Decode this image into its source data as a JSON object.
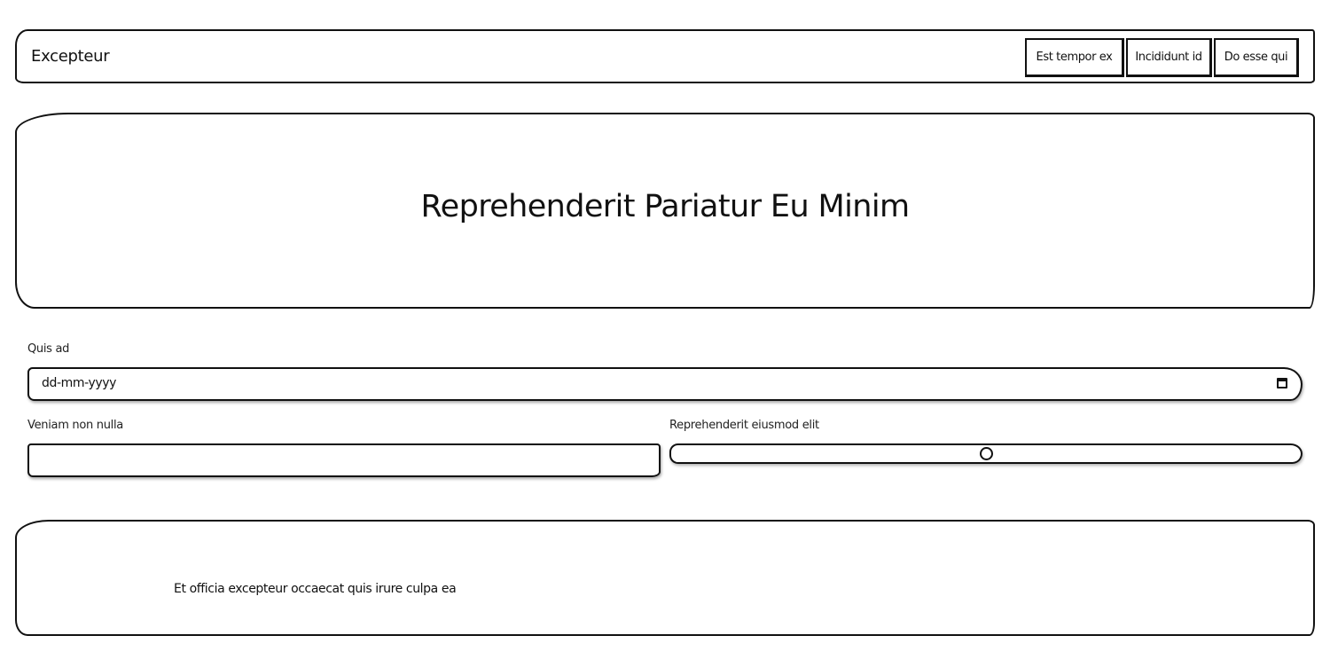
{
  "header": {
    "brand": "Excepteur",
    "nav": [
      {
        "label": "Est tempor ex"
      },
      {
        "label": "Incididunt id"
      },
      {
        "label": "Do esse qui"
      }
    ]
  },
  "hero": {
    "title": "Reprehenderit Pariatur Eu Minim"
  },
  "form": {
    "date_field": {
      "label": "Quis ad",
      "placeholder": "dd-mm-yyyy",
      "icon": "calendar-icon"
    },
    "text_field": {
      "label": "Veniam non nulla",
      "value": ""
    },
    "range_field": {
      "label": "Reprehenderit eiusmod elit",
      "value": 50,
      "min": 0,
      "max": 100
    }
  },
  "footer": {
    "text": "Et officia excepteur occaecat quis irure culpa ea"
  }
}
